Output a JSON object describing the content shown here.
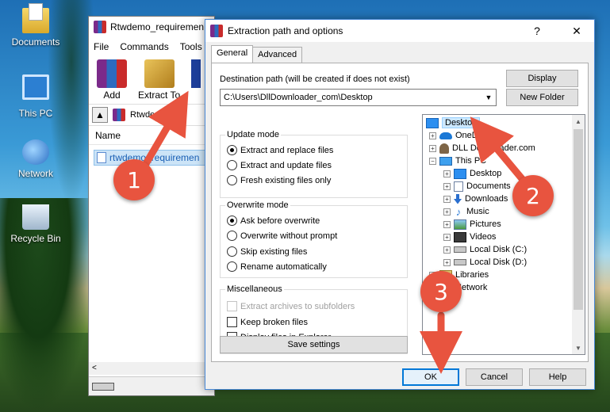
{
  "desktop": {
    "icons": [
      {
        "label": "Documents",
        "icon": "folder-documents-icon"
      },
      {
        "label": "This PC",
        "icon": "computer-icon"
      },
      {
        "label": "Network",
        "icon": "network-globe-icon"
      },
      {
        "label": "Recycle Bin",
        "icon": "recycle-bin-icon"
      }
    ]
  },
  "winrar": {
    "title": "Rtwdemo_requiremen",
    "menu": [
      "File",
      "Commands",
      "Tools"
    ],
    "toolbar": {
      "add": "Add",
      "extract_to": "Extract To"
    },
    "address": "Rtwdemo_re",
    "column_name": "Name",
    "file_row": "rtwdemo_requiremen",
    "scroll_left": "<"
  },
  "dialog": {
    "title": "Extraction path and options",
    "help_glyph": "?",
    "close_glyph": "✕",
    "tabs": [
      "General",
      "Advanced"
    ],
    "dest_label": "Destination path (will be created if does not exist)",
    "dest_value": "C:\\Users\\DllDownloader_com\\Desktop",
    "btn_display": "Display",
    "btn_new_folder": "New Folder",
    "update_mode": {
      "title": "Update mode",
      "options": [
        "Extract and replace files",
        "Extract and update files",
        "Fresh existing files only"
      ],
      "selected": 0
    },
    "overwrite_mode": {
      "title": "Overwrite mode",
      "options": [
        "Ask before overwrite",
        "Overwrite without prompt",
        "Skip existing files",
        "Rename automatically"
      ],
      "selected": 0
    },
    "misc": {
      "title": "Miscellaneous",
      "options": [
        "Extract archives to subfolders",
        "Keep broken files",
        "Display files in Explorer"
      ]
    },
    "btn_save_settings": "Save settings",
    "tree": [
      {
        "label": "Desktop",
        "icon": "desktop-icon"
      },
      {
        "label": "OneDrive",
        "icon": "onedrive-cloud-icon"
      },
      {
        "label": "DLL Downloader.com",
        "icon": "user-folder-icon"
      },
      {
        "label": "This PC",
        "icon": "computer-icon"
      },
      {
        "label": "Desktop",
        "icon": "desktop-icon"
      },
      {
        "label": "Documents",
        "icon": "documents-icon"
      },
      {
        "label": "Downloads",
        "icon": "downloads-icon"
      },
      {
        "label": "Music",
        "icon": "music-icon"
      },
      {
        "label": "Pictures",
        "icon": "pictures-icon"
      },
      {
        "label": "Videos",
        "icon": "videos-icon"
      },
      {
        "label": "Local Disk (C:)",
        "icon": "disk-icon"
      },
      {
        "label": "Local Disk (D:)",
        "icon": "disk-icon"
      },
      {
        "label": "Libraries",
        "icon": "libraries-icon"
      },
      {
        "label": "Network",
        "icon": "network-icon"
      }
    ],
    "btn_ok": "OK",
    "btn_cancel": "Cancel",
    "btn_help": "Help"
  },
  "callouts": [
    "1",
    "2",
    "3"
  ],
  "colors": {
    "callout": "#e8543f",
    "accent": "#0078d7",
    "selection": "#cce8ff"
  }
}
